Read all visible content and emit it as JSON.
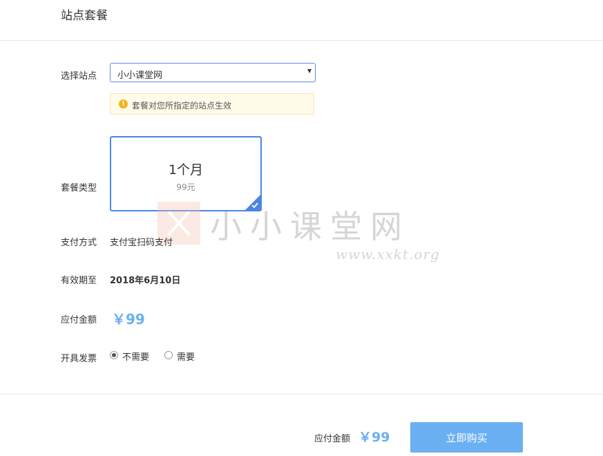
{
  "header": {
    "title": "站点套餐"
  },
  "site": {
    "label": "选择站点",
    "selected": "小小课堂网",
    "notice": "套餐对您所指定的站点生效",
    "notice_icon": "exclamation-icon"
  },
  "plan": {
    "label": "套餐类型",
    "name": "1个月",
    "price": "99元",
    "selected": true
  },
  "payment": {
    "label": "支付方式",
    "value": "支付宝扫码支付"
  },
  "expiry": {
    "label": "有效期至",
    "value": "2018年6月10日"
  },
  "amount": {
    "label": "应付金额",
    "value": "￥99"
  },
  "invoice": {
    "label": "开具发票",
    "options": [
      {
        "label": "不需要",
        "checked": true
      },
      {
        "label": "需要",
        "checked": false
      }
    ]
  },
  "footer": {
    "amount_label": "应付金额",
    "amount_value": "￥99",
    "buy_label": "立即购买"
  },
  "watermark": {
    "text": "小小课堂网",
    "url": "www.xxkt.org"
  },
  "colors": {
    "accent": "#4a86e0",
    "price": "#6ab0f3",
    "button": "#6ab0f3",
    "notice_bg": "#fffbe9",
    "notice_border": "#fae5b0",
    "warning": "#f5b31b"
  }
}
